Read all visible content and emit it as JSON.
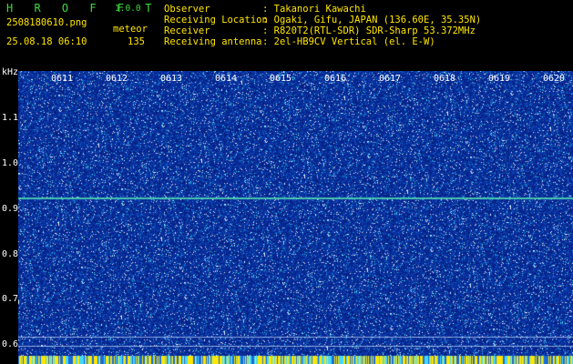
{
  "header": {
    "logo": "H R O F F T",
    "version": "1.0.0",
    "filename": "2508180610.png",
    "mode": "meteor",
    "datetime": "25.08.18 06:10",
    "count": "135"
  },
  "meta": [
    {
      "key": "Observer",
      "value": ": Takanori Kawachi"
    },
    {
      "key": "Receiving Location",
      "value": ": Ogaki, Gifu, JAPAN (136.60E, 35.35N)"
    },
    {
      "key": "Receiver",
      "value": ": R820T2(RTL-SDR) SDR-Sharp 53.372MHz"
    },
    {
      "key": "Receiving antenna",
      "value": ": 2el-HB9CV Vertical (el. E-W)"
    }
  ],
  "axis": {
    "unit": "kHz",
    "y_ticks": [
      "1.1",
      "1.0",
      "0.9",
      "0.8",
      "0.7",
      "0.6"
    ],
    "x_ticks": [
      "0611",
      "0612",
      "0613",
      "0614",
      "0615",
      "0616",
      "0617",
      "0618",
      "0619",
      "0620"
    ]
  },
  "colors": {
    "background": "#000000",
    "spectrogram_base": "#0a2ca8",
    "header_green": "#3cdc3c",
    "header_yellow": "#ffe600",
    "trace_line": "#3fd9a0"
  }
}
